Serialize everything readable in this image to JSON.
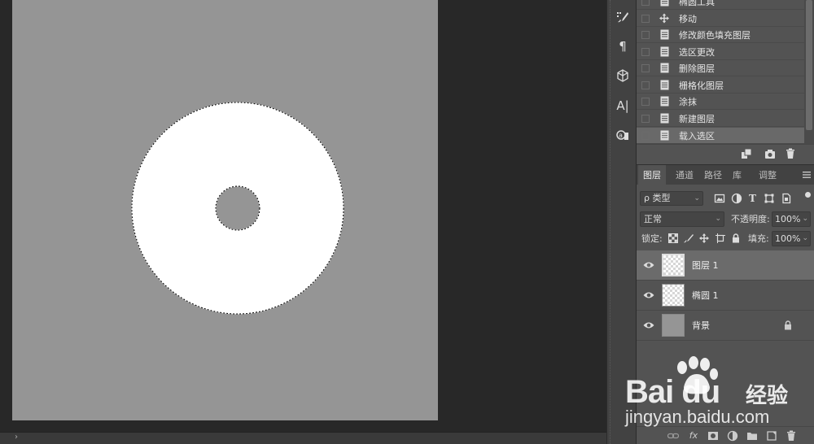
{
  "canvas": {
    "background_color": "#959595",
    "shape_color": "#ffffff",
    "status_arrow": "›"
  },
  "toolstrip": {
    "buttons": [
      "brush-presets-icon",
      "paragraph-icon",
      "3d-icon",
      "character-icon",
      "glyphs-icon"
    ],
    "paragraph_glyph": "¶",
    "character_glyph": "A|"
  },
  "history": {
    "items": [
      {
        "label": "椭圆工具",
        "icon": "doc-icon"
      },
      {
        "label": "移动",
        "icon": "move-icon"
      },
      {
        "label": "修改颜色填充图层",
        "icon": "doc-icon"
      },
      {
        "label": "选区更改",
        "icon": "doc-icon"
      },
      {
        "label": "删除图层",
        "icon": "doc-icon"
      },
      {
        "label": "栅格化图层",
        "icon": "doc-icon"
      },
      {
        "label": "涂抹",
        "icon": "doc-icon"
      },
      {
        "label": "新建图层",
        "icon": "doc-icon"
      },
      {
        "label": "载入选区",
        "icon": "doc-icon",
        "active": true
      }
    ]
  },
  "layers_panel": {
    "tabs": [
      "图层",
      "通道",
      "路径",
      "库",
      "调整"
    ],
    "active_tab": "图层",
    "filter_kind": "类型",
    "filter_prefix": "ρ",
    "blend_mode": "正常",
    "opacity_label": "不透明度:",
    "opacity_value": "100%",
    "lock_label": "锁定:",
    "fill_label": "填充:",
    "fill_value": "100%",
    "layers": [
      {
        "name": "图层 1",
        "selected": true,
        "visible": true,
        "thumb": "checker-selected"
      },
      {
        "name": "椭圆 1",
        "selected": false,
        "visible": true,
        "thumb": "checker"
      },
      {
        "name": "背景",
        "selected": false,
        "visible": true,
        "thumb": "gray",
        "locked": true
      }
    ],
    "footer_fx": "fx"
  },
  "watermark": {
    "brand": "Bai du",
    "brand_suffix": "经验",
    "url": "jingyan.baidu.com"
  }
}
